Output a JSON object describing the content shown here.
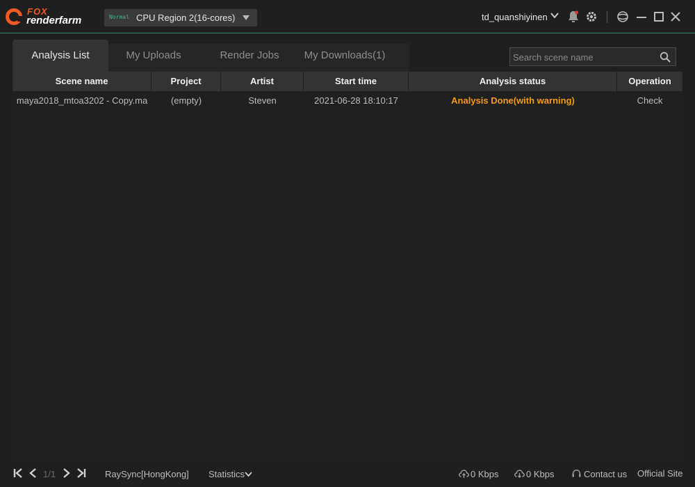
{
  "app": {
    "logo_top": "FOX",
    "logo_bottom": "renderfarm",
    "region_badge": "Normal",
    "region_label": "CPU Region 2(16-cores)",
    "username": "td_quanshiyinen"
  },
  "tabs": [
    {
      "label": "Analysis List",
      "active": true
    },
    {
      "label": "My Uploads",
      "active": false
    },
    {
      "label": "Render Jobs",
      "active": false
    },
    {
      "label": "My Downloads(1)",
      "active": false
    }
  ],
  "search": {
    "placeholder": "Search scene name"
  },
  "table": {
    "columns": [
      "Scene name",
      "Project",
      "Artist",
      "Start time",
      "Analysis status",
      "Operation"
    ],
    "rows": [
      {
        "scene": "maya2018_mtoa3202 - Copy.ma",
        "project": "(empty)",
        "artist": "Steven",
        "start_time": "2021-06-28 18:10:17",
        "status": "Analysis Done(with warning)",
        "operation": "Check"
      }
    ]
  },
  "footer": {
    "page": "1/1",
    "transfer_line": "RaySync[HongKong]",
    "statistics": "Statistics",
    "upload_speed": "0 Kbps",
    "download_speed": "0 Kbps",
    "contact": "Contact us",
    "official_site": "Official Site"
  },
  "colors": {
    "accent_line": "#3a8c7a",
    "logo_orange": "#ef5a26",
    "warning_status": "#f39c12",
    "badge_green": "#3fb98a"
  },
  "icons": [
    "bell-icon",
    "gear-icon",
    "skin-icon",
    "minimize-icon",
    "maximize-icon",
    "close-icon",
    "search-icon",
    "first-page-icon",
    "prev-page-icon",
    "next-page-icon",
    "last-page-icon",
    "upload-cloud-icon",
    "download-cloud-icon",
    "headset-icon"
  ]
}
